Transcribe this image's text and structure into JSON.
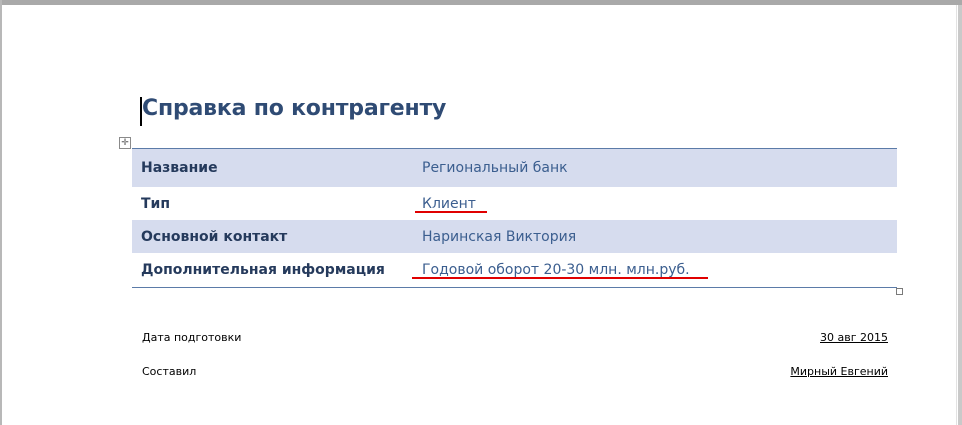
{
  "document": {
    "title": "Справка по контрагенту"
  },
  "table": {
    "rows": [
      {
        "label": "Название",
        "value": "Региональный банк"
      },
      {
        "label": "Тип",
        "value": "Клиент"
      },
      {
        "label": "Основной контакт",
        "value": "Наринская Виктория"
      },
      {
        "label": "Дополнительная информация",
        "value": "Годовой оборот 20-30 млн. млн.руб."
      }
    ]
  },
  "footer": {
    "date_label": "Дата подготовки",
    "date_value": "30 авг 2015",
    "author_label": "Составил",
    "author_value": "Мирный Евгений"
  },
  "colors": {
    "heading": "#2f4b74",
    "row_shade": "#d6dcee",
    "label_text": "#253a5c",
    "value_text": "#3b5e8f",
    "spellcheck_underline": "#e00000"
  }
}
